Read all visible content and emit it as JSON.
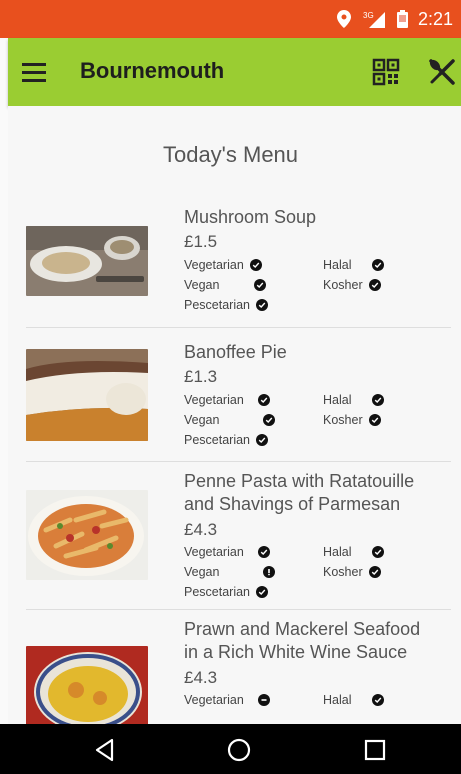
{
  "status": {
    "time": "2:21",
    "network": "3G"
  },
  "appbar": {
    "title": "Bournemouth"
  },
  "page": {
    "heading": "Today's Menu"
  },
  "menu": [
    {
      "name_lines": [
        "Mushroom Soup"
      ],
      "price": "£1.5",
      "diet": {
        "vegetarian": {
          "label": "Vegetarian",
          "status": "check"
        },
        "vegan": {
          "label": "Vegan",
          "status": "check"
        },
        "pescetarian": {
          "label": "Pescetarian",
          "status": "check"
        },
        "halal": {
          "label": "Halal",
          "status": "check"
        },
        "kosher": {
          "label": "Kosher",
          "status": "check"
        }
      }
    },
    {
      "name_lines": [
        "Banoffee Pie"
      ],
      "price": "£1.3",
      "diet": {
        "vegetarian": {
          "label": "Vegetarian",
          "status": "check"
        },
        "vegan": {
          "label": "Vegan",
          "status": "check"
        },
        "pescetarian": {
          "label": "Pescetarian",
          "status": "check"
        },
        "halal": {
          "label": "Halal",
          "status": "check"
        },
        "kosher": {
          "label": "Kosher",
          "status": "check"
        }
      }
    },
    {
      "name_lines": [
        "Penne Pasta with Ratatouille",
        "and Shavings of Parmesan"
      ],
      "price": "£4.3",
      "diet": {
        "vegetarian": {
          "label": "Vegetarian",
          "status": "check"
        },
        "vegan": {
          "label": "Vegan",
          "status": "warning"
        },
        "pescetarian": {
          "label": "Pescetarian",
          "status": "check"
        },
        "halal": {
          "label": "Halal",
          "status": "check"
        },
        "kosher": {
          "label": "Kosher",
          "status": "check"
        }
      }
    },
    {
      "name_lines": [
        "Prawn and Mackerel Seafood",
        "in a Rich White Wine Sauce"
      ],
      "price": "£4.3",
      "diet": {
        "vegetarian": {
          "label": "Vegetarian",
          "status": "minus"
        },
        "halal": {
          "label": "Halal",
          "status": "check"
        }
      }
    }
  ],
  "colors": {
    "statusbar": "#e8501e",
    "appbar": "#9acd32",
    "navbar": "#000000"
  }
}
